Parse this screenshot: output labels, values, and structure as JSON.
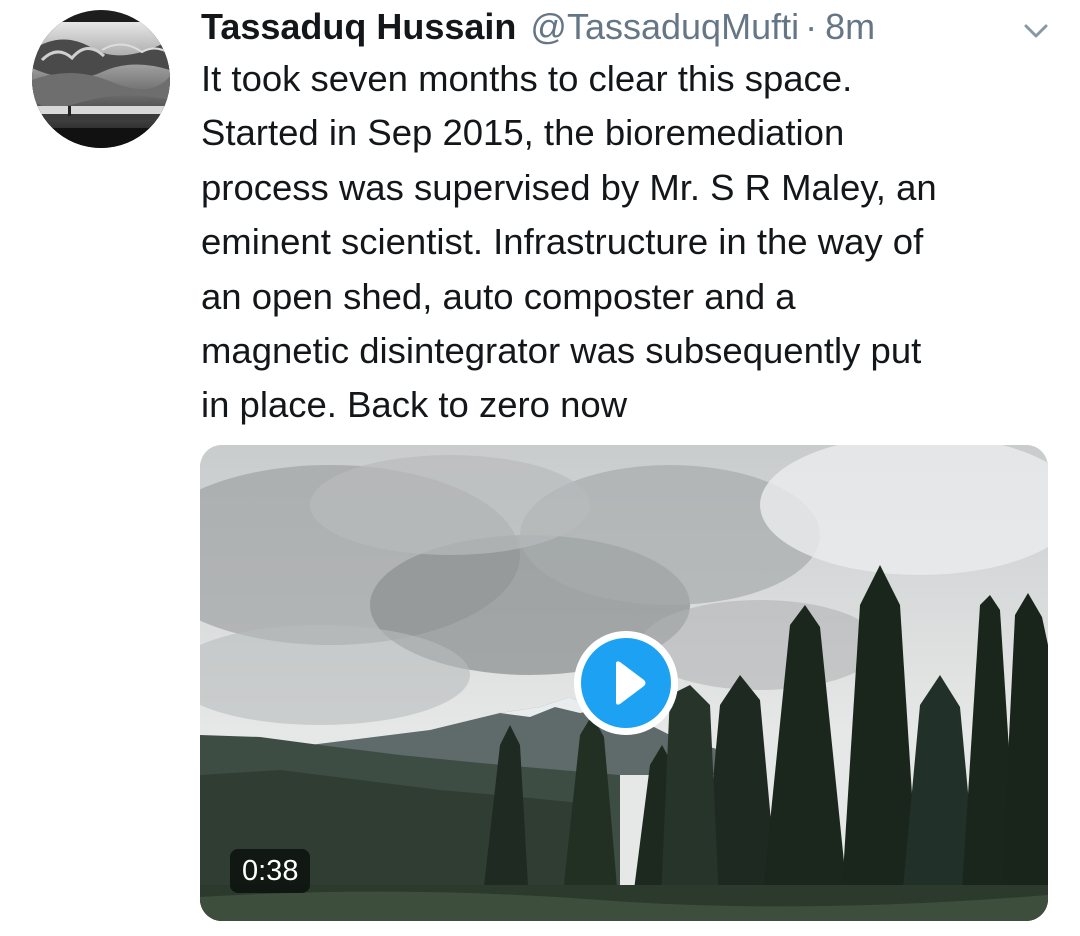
{
  "tweet": {
    "author_name": "Tassaduq Hussain",
    "handle": "@TassaduqMufti",
    "separator": "·",
    "time": "8m",
    "menu_icon": "chevron-down-icon",
    "text_lines": [
      "It took seven months to clear this space.",
      "Started in Sep 2015,  the bioremediation",
      "process was supervised by Mr. S R Maley, an",
      "eminent scientist. Infrastructure in the way of",
      "an open shed, auto composter and a",
      "magnetic disintegrator was subsequently put",
      "in place. Back to zero now"
    ],
    "media": {
      "type": "video",
      "duration": "0:38",
      "play_icon": "play-icon",
      "scene": "cloudy sky over snow-capped mountain and conifer forest"
    },
    "colors": {
      "accent": "#1da1f2",
      "name": "#14171a",
      "secondary": "#657786"
    }
  }
}
